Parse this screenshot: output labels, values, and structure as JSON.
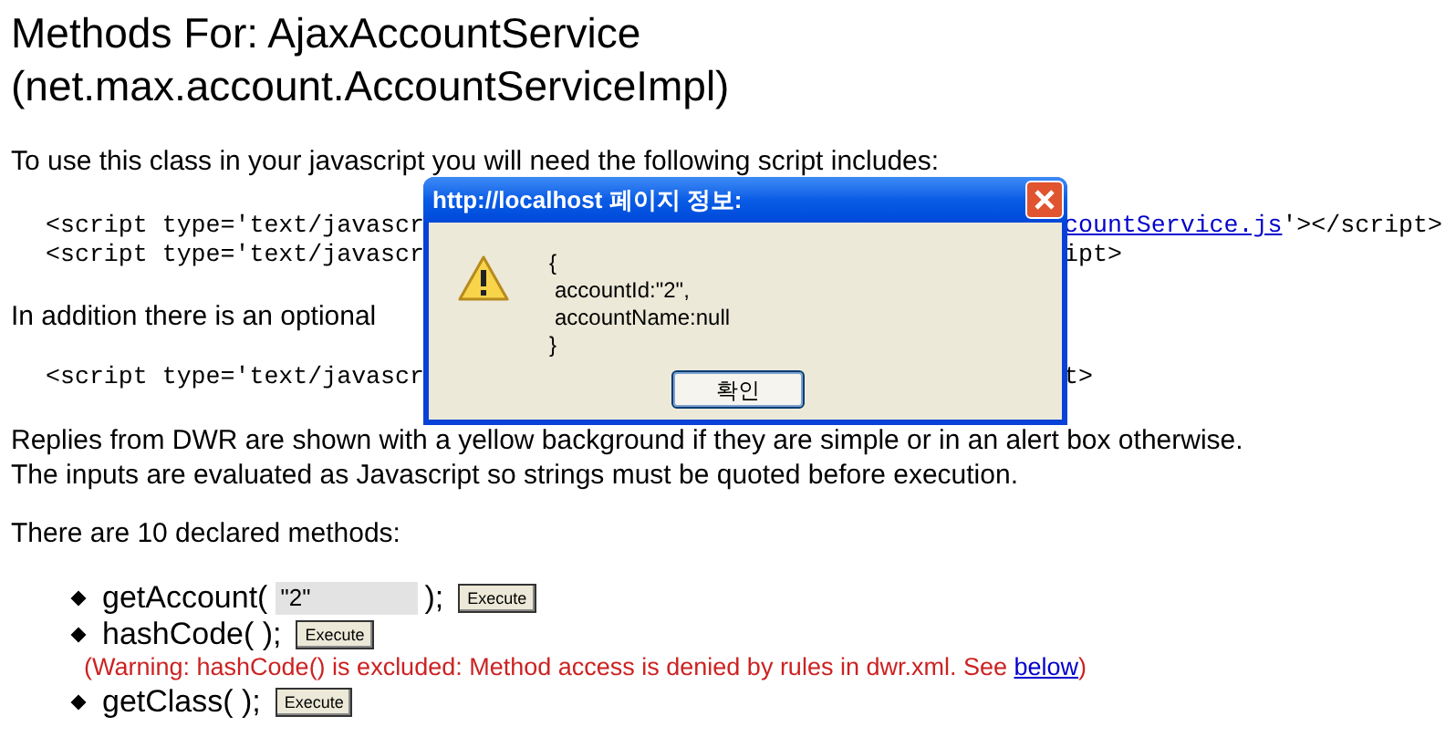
{
  "heading": [
    "Methods For: AjaxAccountService",
    "(net.max.account.AccountServiceImpl)"
  ],
  "intro": "To use this class in your javascript you will need the following script includes:",
  "script_lines": [
    {
      "left": "<script type='text/javascr",
      "link": "countService.js",
      "right": "'></script>"
    },
    {
      "left": "<script type='text/javascr",
      "right": "ipt>"
    }
  ],
  "optional_note": "In addition there is an optional",
  "optional_script": {
    "left": "<script type='text/javascr",
    "right": "t>"
  },
  "replies_note": [
    "Replies from DWR are shown with a yellow background if they are simple or in an alert box otherwise.",
    "The inputs are evaluated as Javascript so strings must be quoted before execution."
  ],
  "methods_count": "There are 10 declared methods:",
  "methods": [
    {
      "kind": "input",
      "name": "getAccount(",
      "value": "\"2\"",
      "close": ");",
      "button": "Execute"
    },
    {
      "kind": "plain",
      "name": "hashCode( );",
      "button": "Execute",
      "warning": {
        "text": "(Warning: hashCode() is excluded: Method access is denied by rules in dwr.xml. See ",
        "link": "below",
        "end": ")"
      }
    },
    {
      "kind": "plain",
      "name": "getClass( );",
      "button": "Execute"
    }
  ],
  "dialog": {
    "title": "http://localhost 페이지 정보:",
    "message": [
      "{",
      "accountId:\"2\",",
      "accountName:null",
      "}"
    ],
    "button": "확인"
  }
}
